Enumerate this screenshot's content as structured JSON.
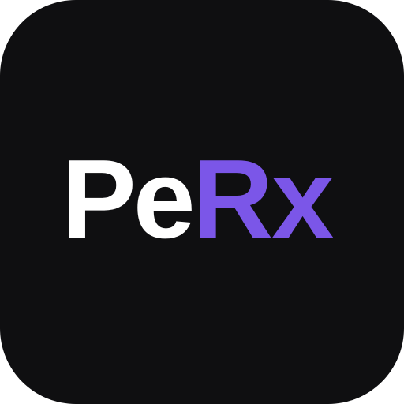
{
  "logo": {
    "primary_text": "Pe",
    "accent_text": "Rx"
  },
  "colors": {
    "background": "#0f0f11",
    "primary_text": "#ffffff",
    "accent_text": "#7b56e8"
  }
}
